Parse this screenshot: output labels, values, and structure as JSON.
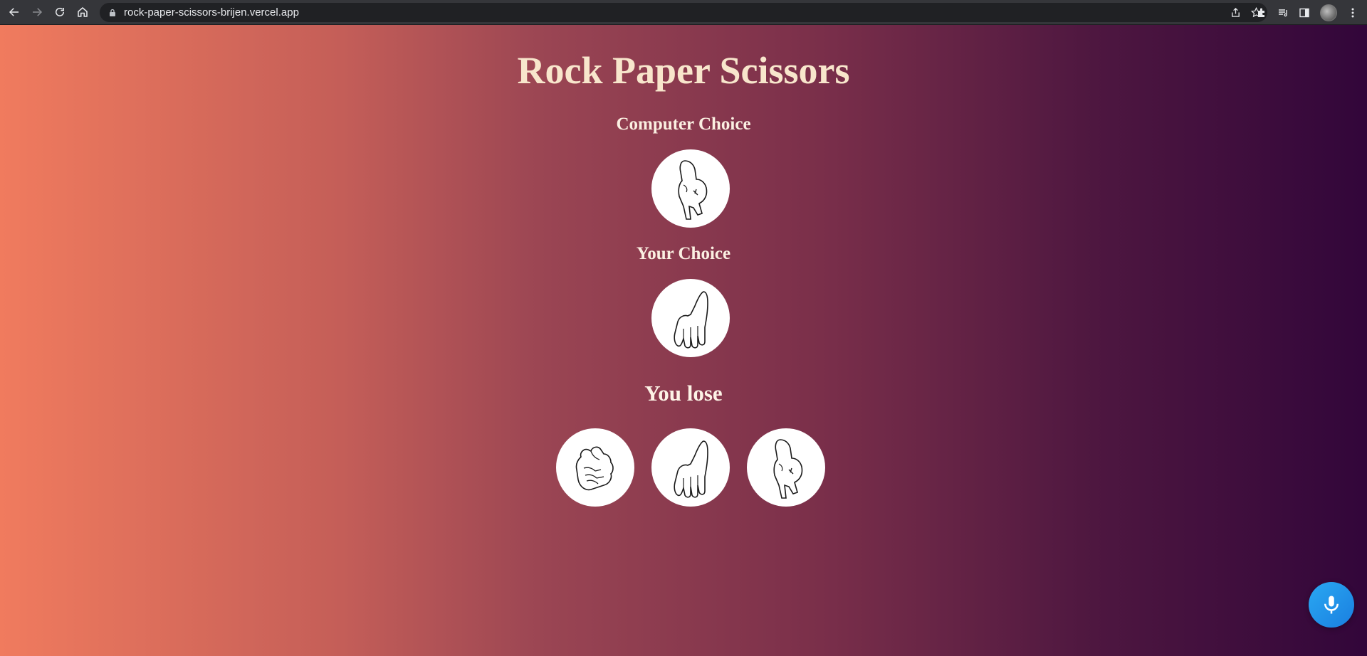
{
  "browser": {
    "url": "rock-paper-scissors-brijen.vercel.app"
  },
  "page": {
    "title": "Rock Paper Scissors",
    "computer_choice_label": "Computer Choice",
    "your_choice_label": "Your Choice",
    "result_text": "You lose"
  },
  "choices": {
    "computer": "scissors",
    "user": "paper",
    "options": [
      "rock",
      "paper",
      "scissors"
    ]
  },
  "icons": {
    "back": "arrow-left-icon",
    "forward": "arrow-right-icon",
    "reload": "reload-icon",
    "home": "home-icon",
    "lock": "lock-icon",
    "share": "share-icon",
    "bookmark": "star-icon",
    "extensions": "puzzle-icon",
    "media": "media-queue-icon",
    "side_panel": "side-panel-icon",
    "menu": "kebab-menu-icon",
    "mic": "microphone-icon"
  },
  "colors": {
    "gradient_start": "#f07b5e",
    "gradient_end": "#32063a",
    "title": "#f8e6cc",
    "mic_button": "#2196f3"
  }
}
